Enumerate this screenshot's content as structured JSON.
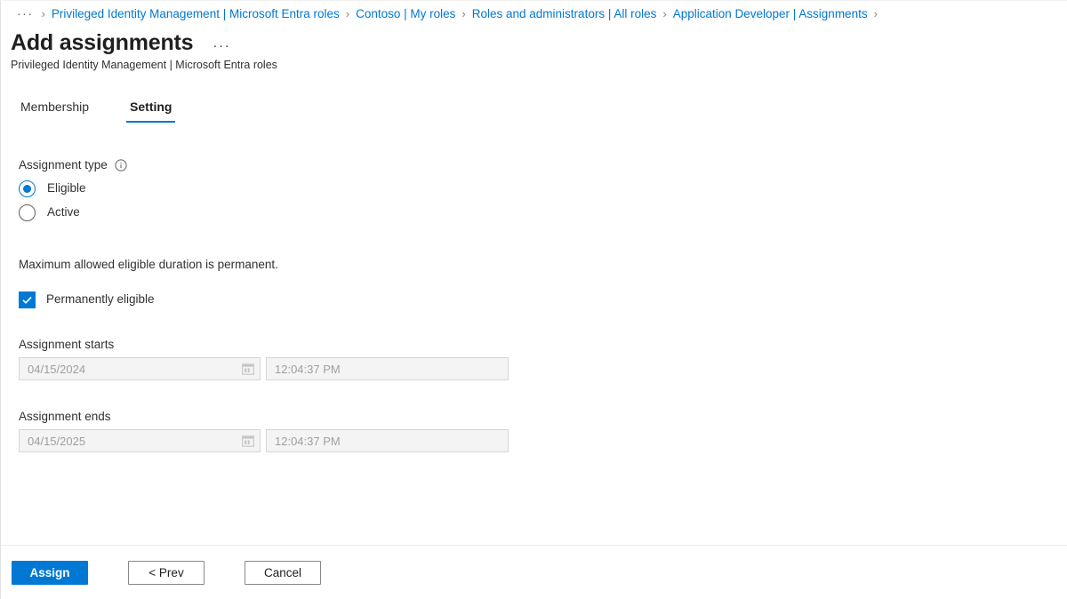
{
  "breadcrumb": {
    "ellipsis": "···",
    "separator": "›",
    "items": [
      "Privileged Identity Management | Microsoft Entra roles",
      "Contoso | My roles",
      "Roles and administrators | All roles",
      "Application Developer | Assignments"
    ]
  },
  "header": {
    "title": "Add assignments",
    "more_label": "···",
    "subtitle": "Privileged Identity Management | Microsoft Entra roles"
  },
  "tabs": [
    {
      "label": "Membership",
      "active": false
    },
    {
      "label": "Setting",
      "active": true
    }
  ],
  "form": {
    "assignment_type": {
      "label": "Assignment type",
      "info_icon": "info-icon",
      "selected": "Eligible",
      "options": [
        {
          "label": "Eligible",
          "checked": true
        },
        {
          "label": "Active",
          "checked": false
        }
      ]
    },
    "duration_note": "Maximum allowed eligible duration is permanent.",
    "permanent_checkbox": {
      "label": "Permanently eligible",
      "checked": true
    },
    "assignment_starts": {
      "label": "Assignment starts",
      "date_value": "04/15/2024",
      "time_value": "12:04:37 PM",
      "calendar_icon": "calendar-icon"
    },
    "assignment_ends": {
      "label": "Assignment ends",
      "date_value": "04/15/2025",
      "time_value": "12:04:37 PM",
      "calendar_icon": "calendar-icon"
    }
  },
  "footer": {
    "assign_label": "Assign",
    "prev_label": "< Prev",
    "cancel_label": "Cancel"
  },
  "colors": {
    "accent": "#0078d4",
    "link": "#0078d4",
    "text": "#323130",
    "disabled_text": "#a19f9d",
    "field_bg": "#f4f4f4"
  }
}
